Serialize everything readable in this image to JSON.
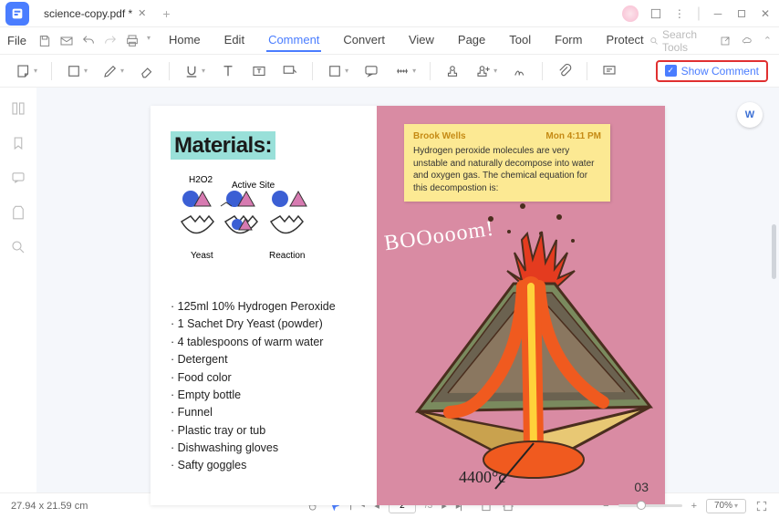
{
  "titlebar": {
    "tab_name": "science-copy.pdf *"
  },
  "menu": {
    "file": "File",
    "items": [
      "Home",
      "Edit",
      "Comment",
      "Convert",
      "View",
      "Page",
      "Tool",
      "Form",
      "Protect"
    ],
    "active_index": 2,
    "search_placeholder": "Search Tools"
  },
  "toolbar": {
    "show_comment": "Show Comment"
  },
  "document": {
    "materials_title": "Materials:",
    "sketch_labels": {
      "h2o2": "H2O2",
      "active_site": "Active Site",
      "yeast": "Yeast",
      "reaction": "Reaction"
    },
    "materials_list": [
      "125ml 10% Hydrogen Peroxide",
      "1 Sachet Dry Yeast (powder)",
      "4 tablespoons of warm water",
      "Detergent",
      "Food color",
      "Empty bottle",
      "Funnel",
      "Plastic tray or tub",
      "Dishwashing gloves",
      "Safty goggles"
    ],
    "boom_text": "BOOooom!",
    "temperature": "4400°c",
    "page_number": "03"
  },
  "note": {
    "author": "Brook Wells",
    "time": "Mon 4:11 PM",
    "body": "Hydrogen peroxide molecules are very unstable and naturally decompose into water and oxygen gas. The chemical equation for this decompostion is:"
  },
  "statusbar": {
    "dimensions": "27.94 x 21.59 cm",
    "page_current": "2",
    "page_total": "/3",
    "zoom": "70%"
  }
}
